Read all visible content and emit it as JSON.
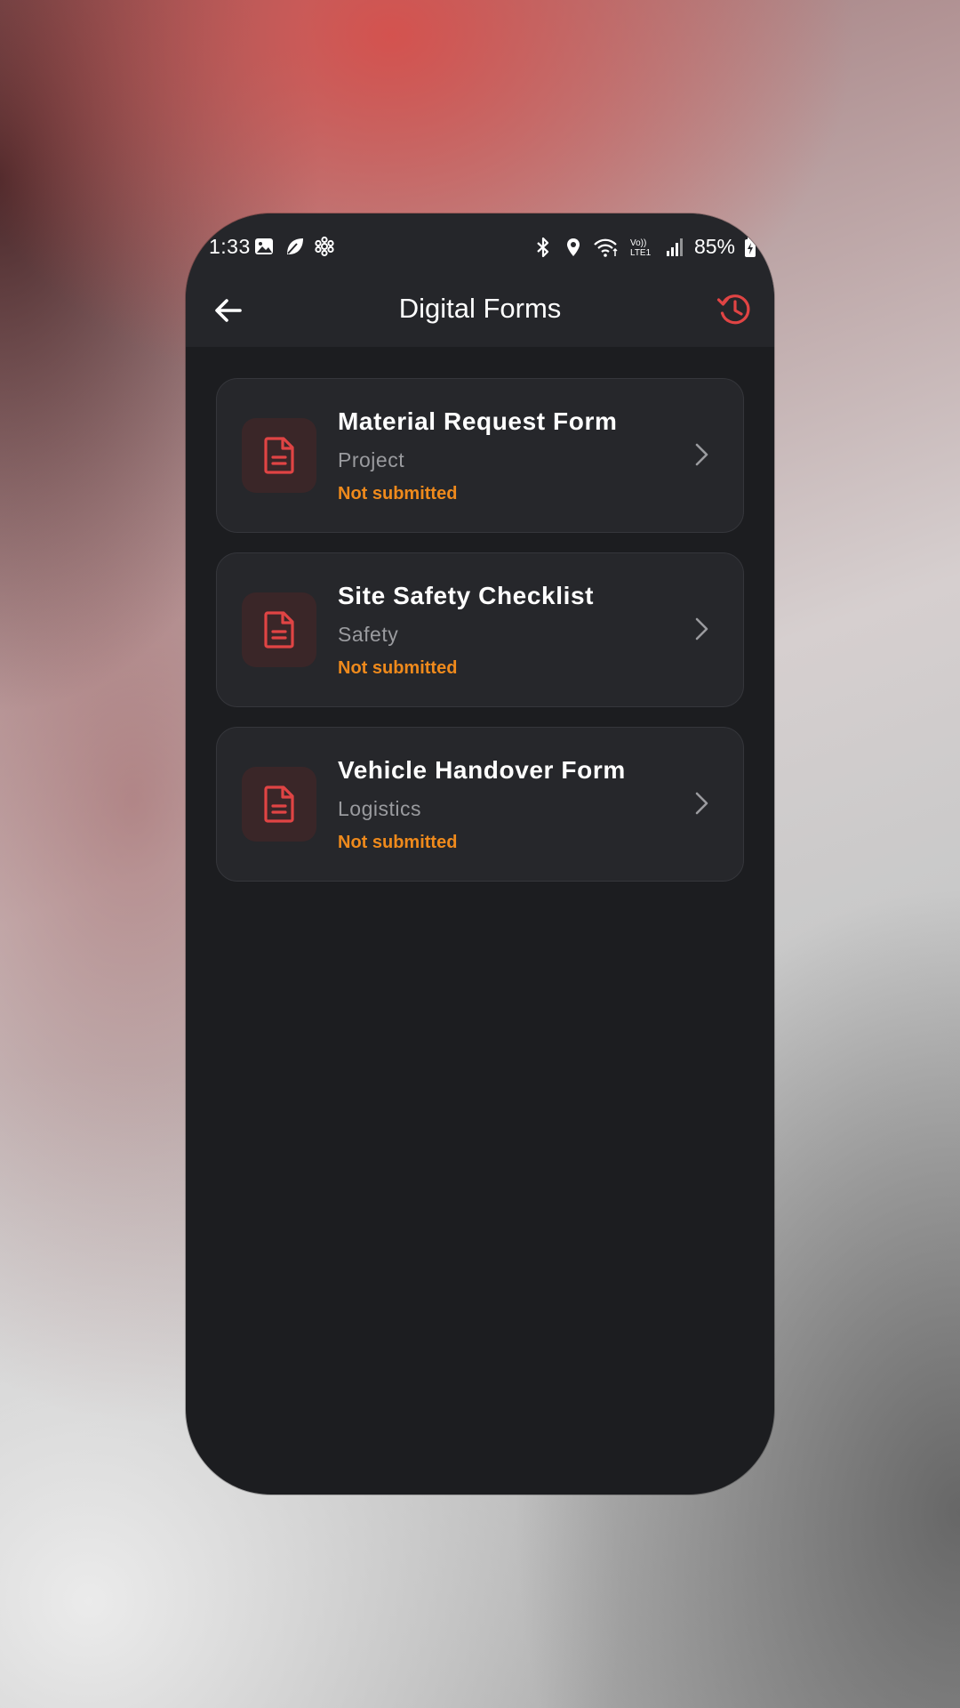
{
  "status_bar": {
    "time": "1:33",
    "battery": "85%",
    "left_icons": [
      "image-icon",
      "leaf-icon",
      "flower-icon"
    ],
    "right_icons": [
      "bluetooth-icon",
      "location-icon",
      "wifi-icon",
      "volte-icon",
      "signal-icon",
      "battery-icon"
    ],
    "volte_label": "Vo))\nLTE1"
  },
  "header": {
    "title": "Digital Forms",
    "back_icon": "arrow-left-icon",
    "history_icon": "history-icon"
  },
  "colors": {
    "accent": "#e04444",
    "status_warning": "#ef8a1c",
    "background": "#1c1d20",
    "card": "#26272b"
  },
  "forms": [
    {
      "title": "Material Request Form",
      "category": "Project",
      "status": "Not submitted"
    },
    {
      "title": "Site Safety Checklist",
      "category": "Safety",
      "status": "Not submitted"
    },
    {
      "title": "Vehicle Handover Form",
      "category": "Logistics",
      "status": "Not submitted"
    }
  ]
}
